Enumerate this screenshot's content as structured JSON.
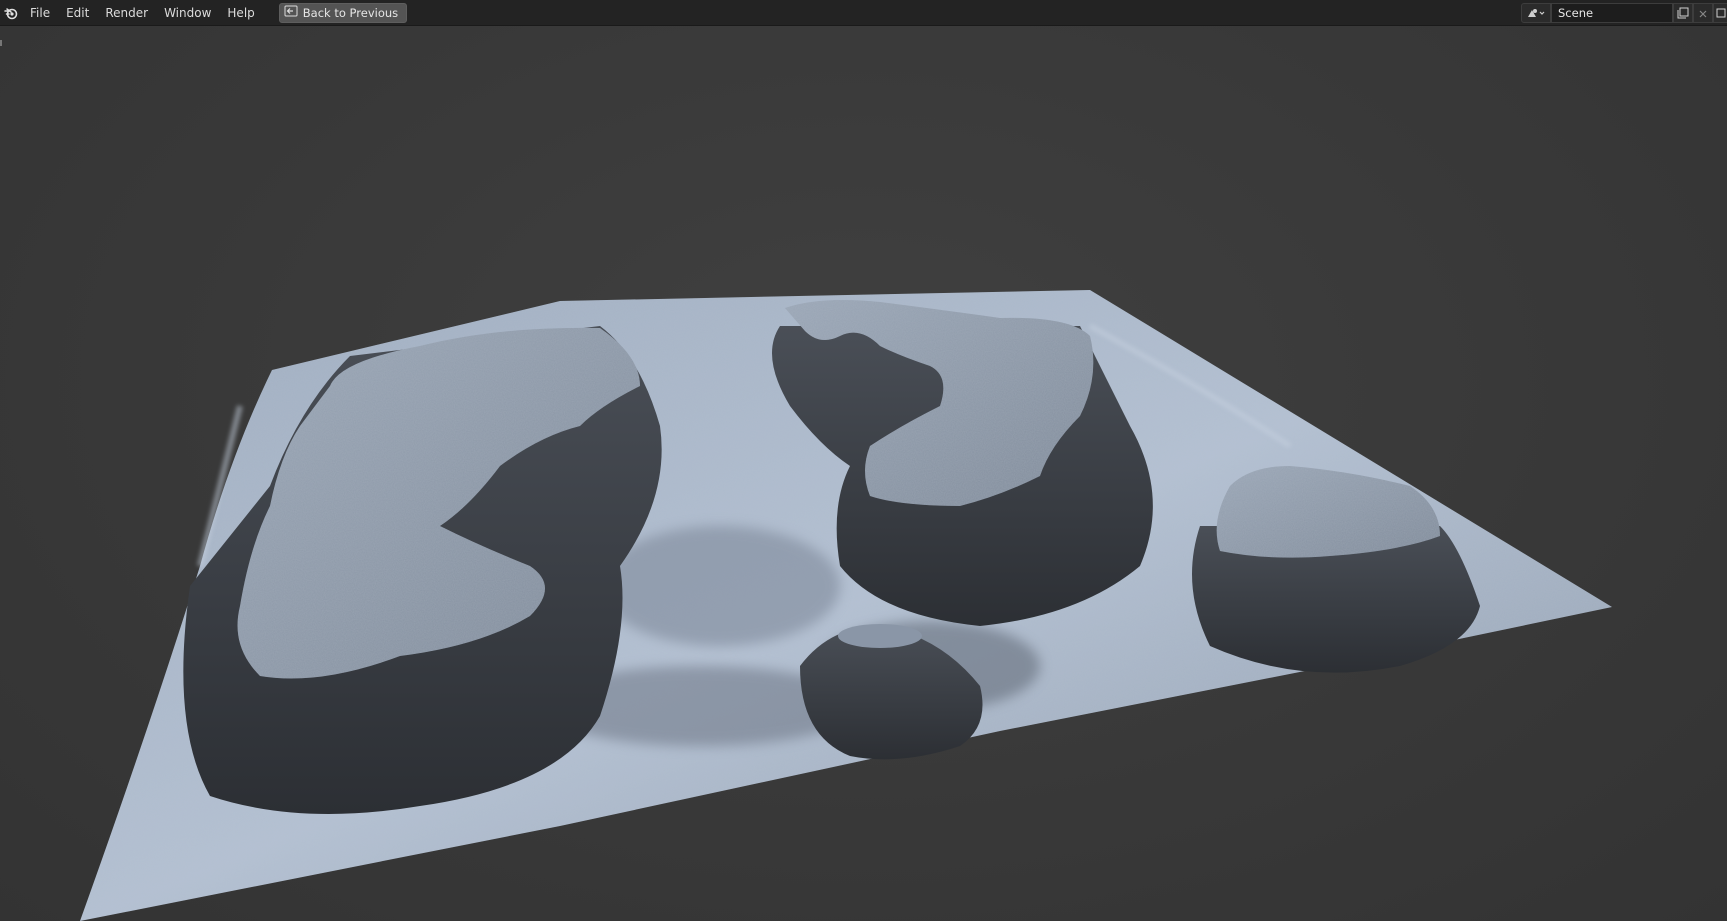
{
  "menu": {
    "file": "File",
    "edit": "Edit",
    "render": "Render",
    "window": "Window",
    "help": "Help"
  },
  "toolbar": {
    "back_label": "Back to Previous"
  },
  "scene": {
    "name": "Scene"
  },
  "colors": {
    "topbar": "#232323",
    "viewport_bg": "#3a3a3a",
    "terrain_light": "#a9b7cb",
    "terrain_shadow": "#2f3236"
  },
  "icons": {
    "logo": "blender-logo-icon",
    "back": "back-to-previous-icon",
    "scene_type": "scene-icon",
    "new_scene": "new-scene-icon",
    "delete_scene": "close-icon"
  }
}
